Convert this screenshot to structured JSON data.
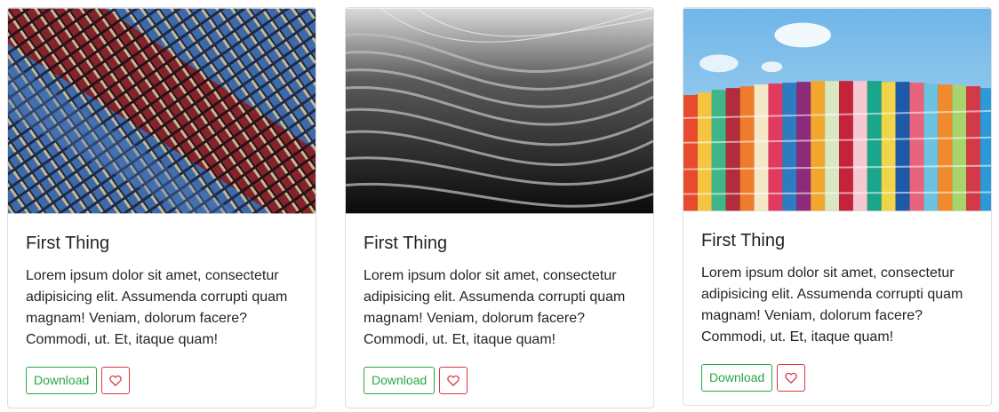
{
  "cards": [
    {
      "title": "First Thing",
      "text": "Lorem ipsum dolor sit amet, consectetur adipisicing elit. Assumenda corrupti quam magnam! Veniam, dolorum facere? Commodi, ut. Et, itaque quam!",
      "download_label": "Download",
      "favorite_icon": "heart-icon",
      "image": "photo of a blue and red glass-paneled building facade"
    },
    {
      "title": "First Thing",
      "text": "Lorem ipsum dolor sit amet, consectetur adipisicing elit. Assumenda corrupti quam magnam! Veniam, dolorum facere? Commodi, ut. Et, itaque quam!",
      "download_label": "Download",
      "favorite_icon": "heart-icon",
      "image": "black and white photo of a curved woven metal facade"
    },
    {
      "title": "First Thing",
      "text": "Lorem ipsum dolor sit amet, consectetur adipisicing elit. Assumenda corrupti quam magnam! Veniam, dolorum facere? Commodi, ut. Et, itaque quam!",
      "download_label": "Download",
      "favorite_icon": "heart-icon",
      "image": "photo of a colorful striped glass building under blue sky"
    }
  ],
  "colors": {
    "success": "#28a745",
    "danger": "#dc3545",
    "text": "#212529",
    "border": "#dfdfdf"
  }
}
